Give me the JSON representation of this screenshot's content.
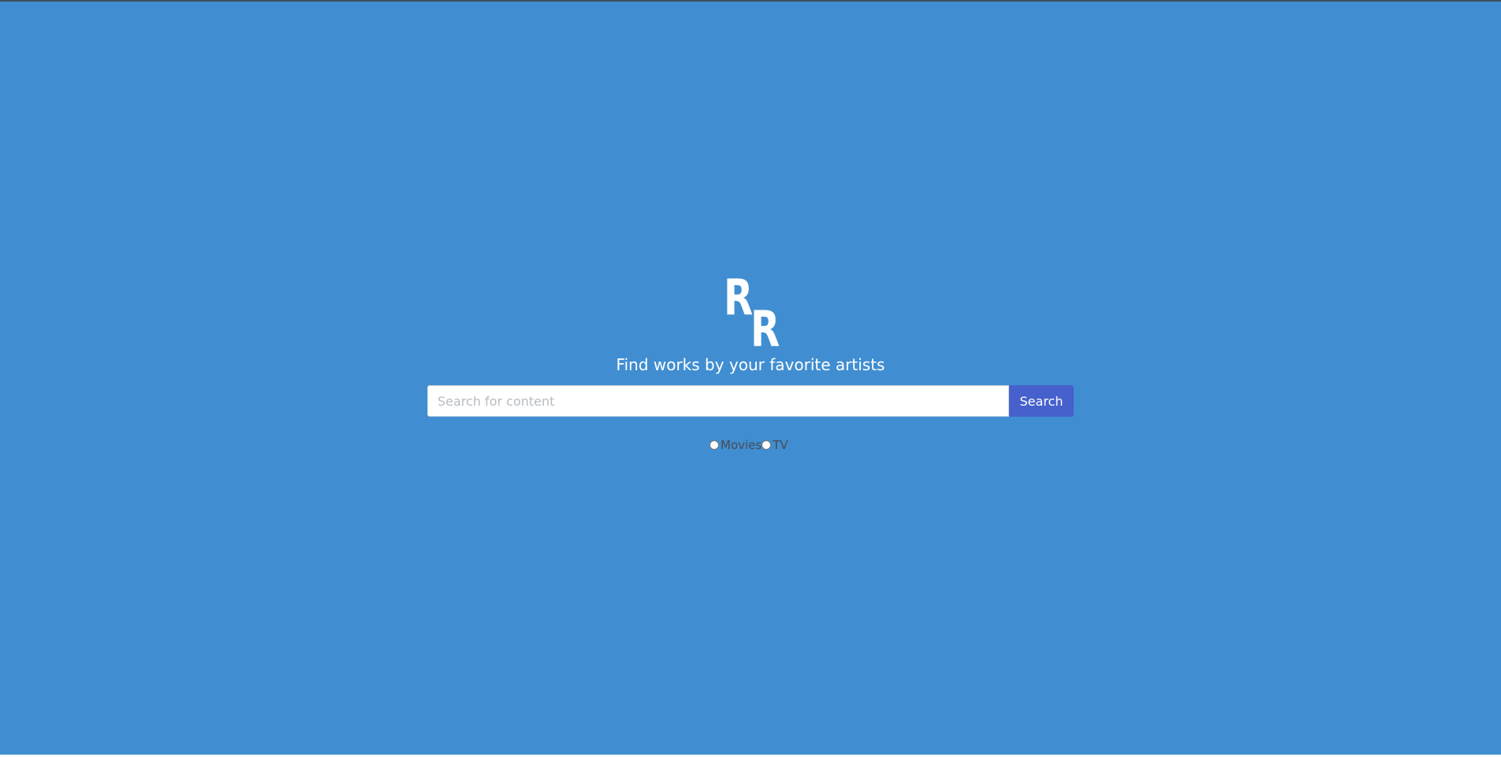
{
  "logo": {
    "letter_top": "R",
    "letter_bottom": "R"
  },
  "tagline": "Find works by your favorite artists",
  "search": {
    "placeholder": "Search for content",
    "value": "",
    "button_label": "Search"
  },
  "filters": [
    {
      "label": "Movies",
      "selected": false
    },
    {
      "label": "TV",
      "selected": false
    }
  ],
  "colors": {
    "hero_background": "#408ed1",
    "search_button": "#4660cc",
    "text_light": "#ffffff",
    "filter_text": "#4a4a52"
  }
}
